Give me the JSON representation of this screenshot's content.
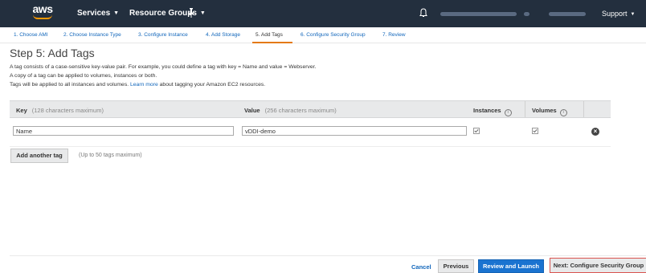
{
  "nav": {
    "logo": "aws",
    "services": "Services",
    "resource_groups": "Resource Groups",
    "support": "Support"
  },
  "steps": [
    {
      "label": "1. Choose AMI"
    },
    {
      "label": "2. Choose Instance Type"
    },
    {
      "label": "3. Configure Instance"
    },
    {
      "label": "4. Add Storage"
    },
    {
      "label": "5. Add Tags",
      "active": true
    },
    {
      "label": "6. Configure Security Group"
    },
    {
      "label": "7. Review"
    }
  ],
  "page": {
    "title": "Step 5: Add Tags",
    "desc1": "A tag consists of a case-sensitive key-value pair. For example, you could define a tag with key = Name and value = Webserver.",
    "desc2": "A copy of a tag can be applied to volumes, instances or both.",
    "desc3_pre": "Tags will be applied to all instances and volumes.",
    "desc3_link": "Learn more",
    "desc3_post": "about tagging your Amazon EC2 resources."
  },
  "table": {
    "headers": {
      "key": "Key",
      "key_hint": "(128 characters maximum)",
      "value": "Value",
      "value_hint": "(256 characters maximum)",
      "instances": "Instances",
      "volumes": "Volumes"
    },
    "rows": [
      {
        "key": "Name",
        "value": "vDDI-demo",
        "instances": true,
        "volumes": true
      }
    ]
  },
  "actions": {
    "add_tag": "Add another tag",
    "add_hint": "(Up to 50 tags maximum)",
    "cancel": "Cancel",
    "previous": "Previous",
    "review": "Review and Launch",
    "next": "Next: Configure Security Group"
  },
  "colors": {
    "nav_bg": "#232f3e",
    "accent": "#e47911",
    "primary": "#1a73d0",
    "link": "#1166bb",
    "highlight_border": "#d9534f"
  },
  "icons": {
    "pin": "pin-icon",
    "bell": "bell-icon",
    "info": "info-icon",
    "check": "checkbox-checked-icon",
    "remove": "remove-circle-icon"
  }
}
